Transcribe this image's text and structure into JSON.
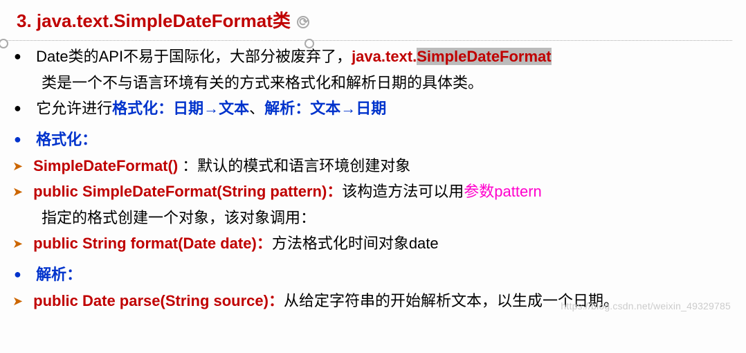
{
  "heading": "3. java.text.SimpleDateFormat类",
  "p1": {
    "a": "Date类的API不易于国际化，大部分被废弃了，",
    "b": "java.text.",
    "c": "SimpleDateFormat",
    "d": "类是一个不与语言环境有关的方式来格式化和解析日期的具体类。"
  },
  "p2": {
    "a": "它允许进行",
    "b": "格式化：日期",
    "arr1": "→",
    "c": "文本",
    "sep": "、",
    "d": "解析：文本",
    "arr2": "→",
    "e": "日期"
  },
  "sec1_title": "格式化：",
  "m1": {
    "a": "SimpleDateFormat() ",
    "b": "：默认的模式和语言环境创建对象"
  },
  "m2": {
    "a": "public SimpleDateFormat(String pattern)：",
    "b": "该构造方法可以用",
    "c": "参数pattern",
    "d": "指定的格式创建一个对象，该对象调用："
  },
  "m3": {
    "a": "public String format(Date date)：",
    "b": "方法格式化时间对象date"
  },
  "sec2_title": "解析：",
  "m4": {
    "a": "public Date parse(String source)：",
    "b": "从给定字符串的开始解析文本，以生成一个日期。"
  },
  "watermark": "https://blog.csdn.net/weixin_49329785"
}
